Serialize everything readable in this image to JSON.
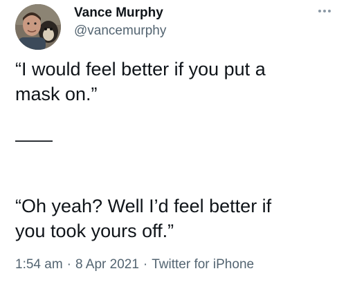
{
  "author": {
    "name": "Vance Murphy",
    "handle": "@vancemurphy"
  },
  "icons": {
    "more": "more-horizontal-icon",
    "avatar": "profile-photo"
  },
  "tweet": {
    "paragraph_1": "“I would feel better if you put a\nmask on.”",
    "divider": "——",
    "paragraph_2": " “Oh yeah? Well I’d feel better if\nyou took yours off.”"
  },
  "meta": {
    "time": "1:54 am",
    "date": "8 Apr 2021",
    "source": "Twitter for iPhone",
    "separator": "·"
  },
  "colors": {
    "text": "#0f1419",
    "secondary": "#536471"
  }
}
